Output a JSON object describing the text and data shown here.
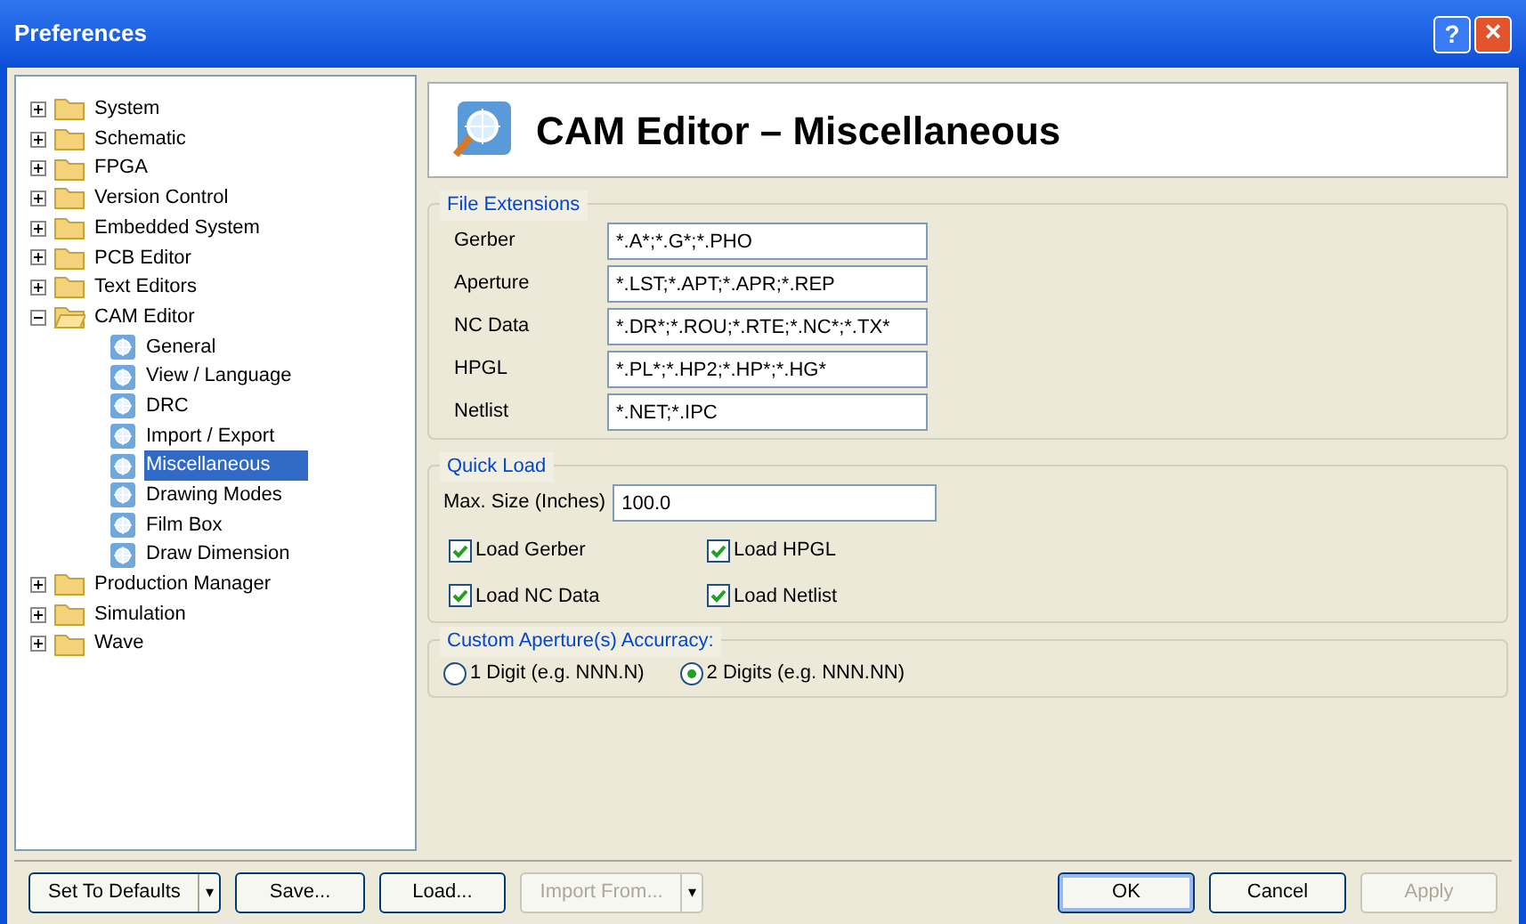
{
  "window": {
    "title": "Preferences",
    "help_button": "?",
    "close_button": "×"
  },
  "tree": [
    {
      "label": "System",
      "kind": "folder",
      "expanded": false,
      "selected": false
    },
    {
      "label": "Schematic",
      "kind": "folder",
      "expanded": false,
      "selected": false
    },
    {
      "label": "FPGA",
      "kind": "folder",
      "expanded": false,
      "selected": false
    },
    {
      "label": "Version Control",
      "kind": "folder",
      "expanded": false,
      "selected": false
    },
    {
      "label": "Embedded System",
      "kind": "folder",
      "expanded": false,
      "selected": false
    },
    {
      "label": "PCB Editor",
      "kind": "folder",
      "expanded": false,
      "selected": false
    },
    {
      "label": "Text Editors",
      "kind": "folder",
      "expanded": false,
      "selected": false
    },
    {
      "label": "CAM Editor",
      "kind": "folder",
      "expanded": true,
      "selected": false,
      "children": [
        {
          "label": "General",
          "kind": "page",
          "selected": false
        },
        {
          "label": "View / Language",
          "kind": "page",
          "selected": false
        },
        {
          "label": "DRC",
          "kind": "page",
          "selected": false
        },
        {
          "label": "Import / Export",
          "kind": "page",
          "selected": false
        },
        {
          "label": "Miscellaneous",
          "kind": "page",
          "selected": true
        },
        {
          "label": "Drawing Modes",
          "kind": "page",
          "selected": false
        },
        {
          "label": "Film Box",
          "kind": "page",
          "selected": false
        },
        {
          "label": "Draw Dimension",
          "kind": "page",
          "selected": false
        }
      ]
    },
    {
      "label": "Production Manager",
      "kind": "folder",
      "expanded": false,
      "selected": false
    },
    {
      "label": "Simulation",
      "kind": "folder",
      "expanded": false,
      "selected": false
    },
    {
      "label": "Wave",
      "kind": "folder",
      "expanded": false,
      "selected": false
    }
  ],
  "page_title": "CAM Editor – Miscellaneous",
  "file_extensions": {
    "title": "File Extensions",
    "fields": [
      {
        "label": "Gerber",
        "value": "*.A*;*.G*;*.PHO"
      },
      {
        "label": "Aperture",
        "value": "*.LST;*.APT;*.APR;*.REP"
      },
      {
        "label": "NC Data",
        "value": "*.DR*;*.ROU;*.RTE;*.NC*;*.TX*"
      },
      {
        "label": "HPGL",
        "value": "*.PL*;*.HP2;*.HP*;*.HG*"
      },
      {
        "label": "Netlist",
        "value": "*.NET;*.IPC"
      }
    ]
  },
  "quick_load": {
    "title": "Quick Load",
    "max_size": {
      "label": "Max. Size (Inches)",
      "value": "100.0"
    },
    "checkboxes": [
      {
        "label": "Load Gerber",
        "checked": true
      },
      {
        "label": "Load HPGL",
        "checked": true
      },
      {
        "label": "Load NC Data",
        "checked": true
      },
      {
        "label": "Load Netlist",
        "checked": true
      }
    ]
  },
  "accuracy": {
    "title": "Custom Aperture(s) Accurracy:",
    "options": [
      {
        "label": "1 Digit (e.g. NNN.N)",
        "selected": false
      },
      {
        "label": "2 Digits (e.g. NNN.NN)",
        "selected": true
      }
    ]
  },
  "buttons_left": [
    {
      "label": "Set To Defaults",
      "kind": "split",
      "disabled": false,
      "caret": "▾"
    },
    {
      "label": "Save...",
      "kind": "plain",
      "disabled": false
    },
    {
      "label": "Load...",
      "kind": "plain",
      "disabled": false
    },
    {
      "label": "Import From...",
      "kind": "split",
      "disabled": true,
      "caret": "▾"
    }
  ],
  "buttons_right": [
    {
      "label": "OK",
      "default": true,
      "disabled": false
    },
    {
      "label": "Cancel",
      "default": false,
      "disabled": false
    },
    {
      "label": "Apply",
      "default": false,
      "disabled": true
    }
  ]
}
